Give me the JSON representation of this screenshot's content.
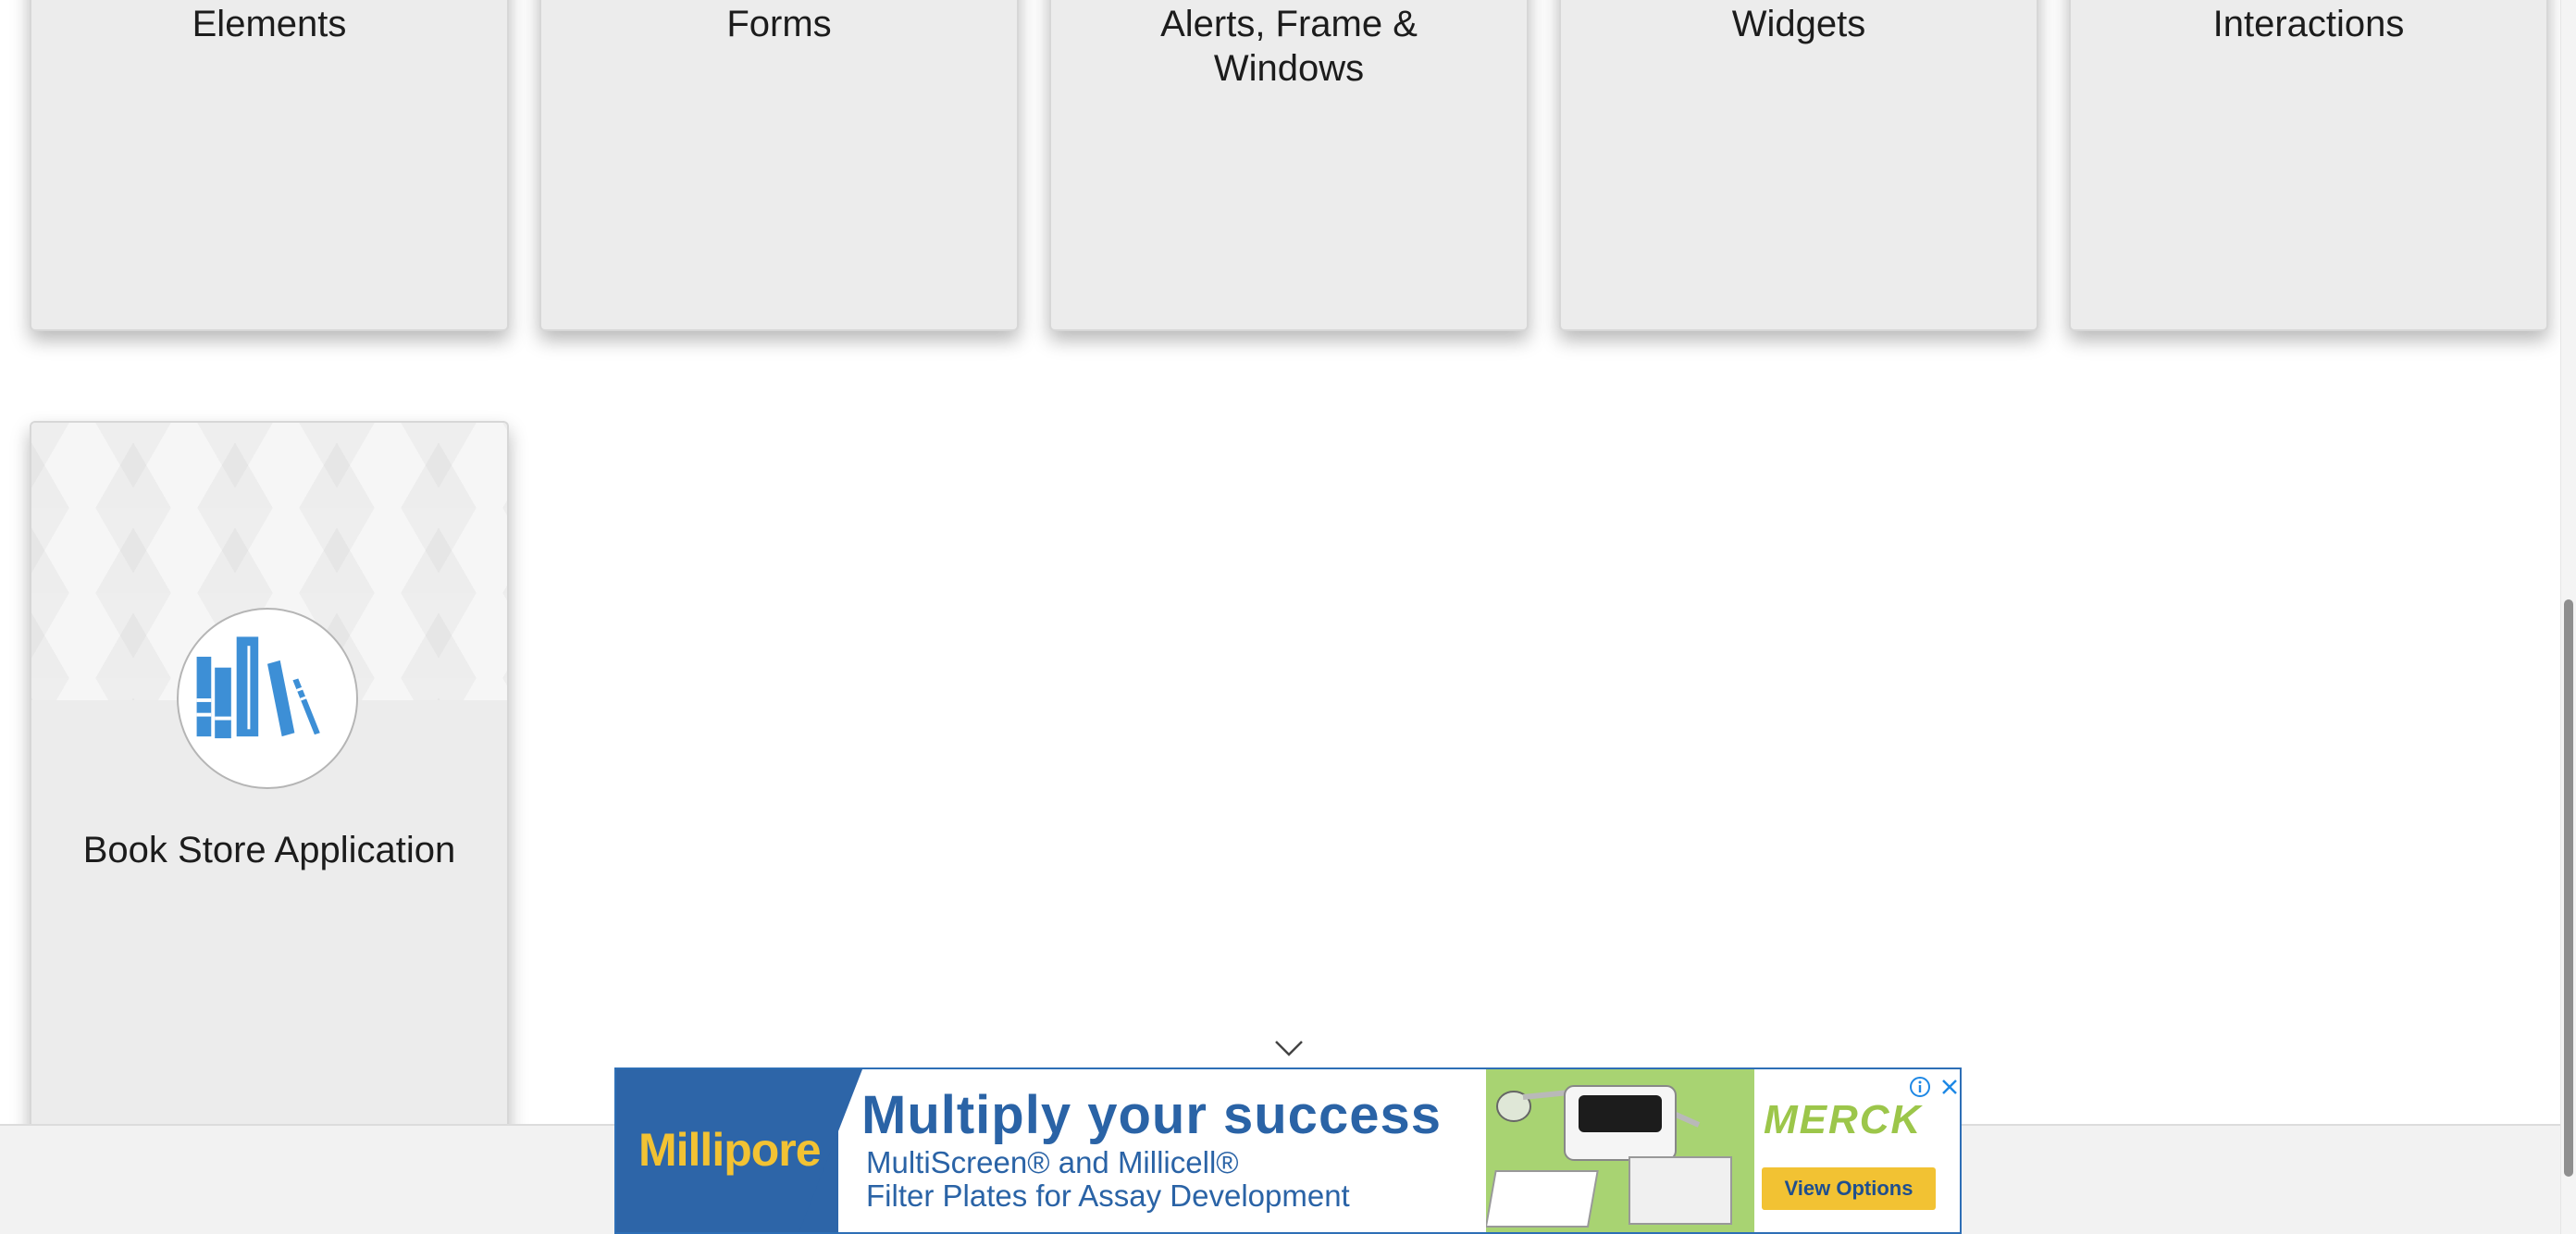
{
  "categories": {
    "top": [
      {
        "title": "Elements"
      },
      {
        "title": "Forms"
      },
      {
        "title": "Alerts, Frame & Windows"
      },
      {
        "title": "Widgets"
      },
      {
        "title": "Interactions"
      }
    ],
    "bookstore": {
      "title": "Book Store Application",
      "icon": "books-icon"
    }
  },
  "ad": {
    "brand": "Millipore",
    "headline": "Multiply your success",
    "line2": "MultiScreen® and Millicell®",
    "line3": "Filter Plates for Assay Development",
    "sponsor": "MERCK",
    "cta": "View Options",
    "info_icon": "info-icon",
    "close_icon": "close-icon"
  },
  "colors": {
    "card_bg": "#ececec",
    "icon_blue": "#3d8fd6",
    "ad_blue": "#2d65a8",
    "ad_yellow": "#f2c233",
    "ad_green": "#9cc64a"
  }
}
